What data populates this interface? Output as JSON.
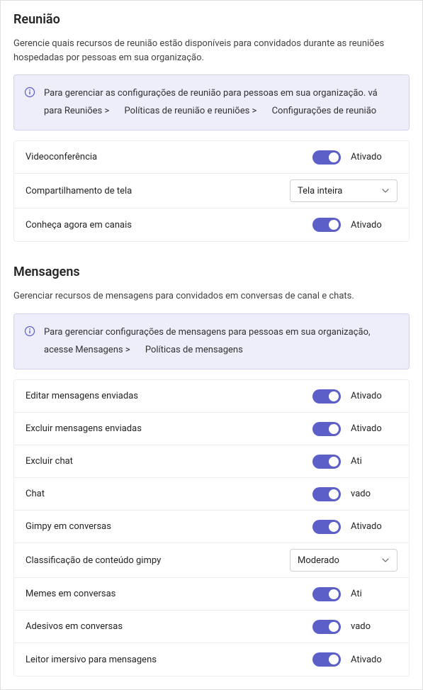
{
  "colors": {
    "accent": "#5b5fc7",
    "info_bg": "#eeeefb",
    "info_border": "#d1d1f0"
  },
  "meeting": {
    "title": "Reunião",
    "description": "Gerencie quais recursos de reunião estão disponíveis para convidados durante as reuniões hospedadas por pessoas em sua organização.",
    "info_segments": [
      "Para gerenciar as configurações de reunião para pessoas em sua organização. vá para Reuniões >",
      "Políticas de reunião e reuniões >",
      "Configurações de reunião"
    ],
    "rows": {
      "video": {
        "label": "Videoconferência",
        "status": "Ativado"
      },
      "screenshare": {
        "label": "Compartilhamento de tela",
        "selected": "Tela inteira"
      },
      "meetnow": {
        "label": "Conheça agora em canais",
        "status": "Ativado"
      }
    }
  },
  "messaging": {
    "title": "Mensagens",
    "description": "Gerenciar recursos de mensagens para convidados em conversas de canal e chats.",
    "info_segments": [
      "Para gerenciar configurações de mensagens para pessoas em sua organização, acesse Mensagens >",
      "Políticas de mensagens"
    ],
    "rows": {
      "edit": {
        "label": "Editar mensagens enviadas",
        "status": "Ativado"
      },
      "delete": {
        "label": "Excluir mensagens enviadas",
        "status": "Ativado"
      },
      "deletechat": {
        "label": "Excluir chat",
        "status": "Ati"
      },
      "chat": {
        "label": "Chat",
        "status": "vado"
      },
      "gimpy": {
        "label": "Gimpy em conversas",
        "status": "Ativado"
      },
      "rating": {
        "label": "Classificação de conteúdo gimpy",
        "selected": "Moderado"
      },
      "memes": {
        "label": "Memes em conversas",
        "status": "Ati"
      },
      "stickers": {
        "label": "Adesivos em conversas",
        "status": "vado"
      },
      "immersive": {
        "label": "Leitor imersivo para mensagens",
        "status": "Ativado"
      }
    }
  }
}
